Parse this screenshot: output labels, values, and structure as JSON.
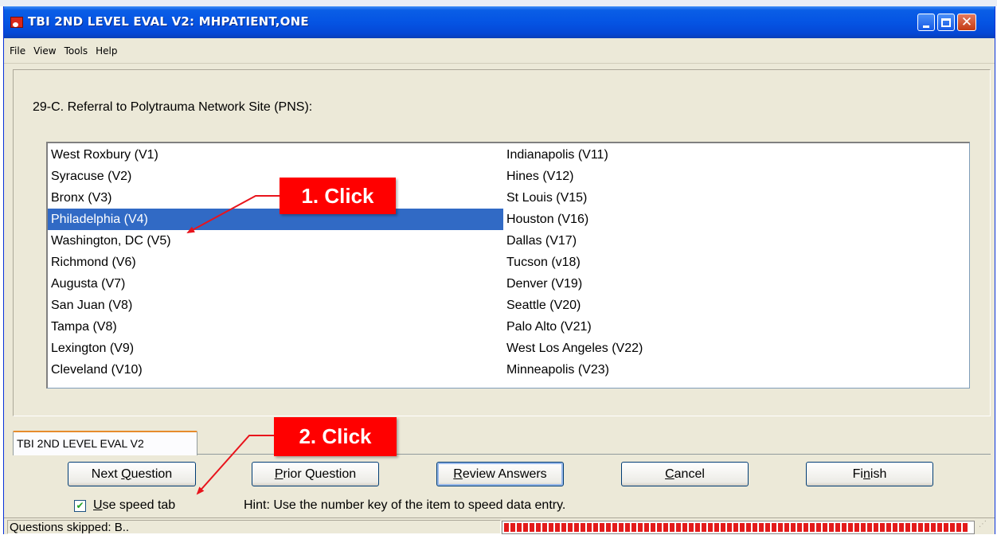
{
  "window": {
    "title": "TBI 2ND LEVEL EVAL V2: MHPATIENT,ONE",
    "controls": {
      "minimize": "minimize-icon",
      "maximize": "maximize-icon",
      "close": "close-icon"
    }
  },
  "menu": [
    "File",
    "View",
    "Tools",
    "Help"
  ],
  "question": {
    "label": "29-C. Referral to Polytrauma Network Site (PNS):"
  },
  "list": {
    "left": [
      "West Roxbury (V1)",
      "Syracuse (V2)",
      "Bronx (V3)",
      "Philadelphia (V4)",
      "Washington, DC (V5)",
      "Richmond (V6)",
      "Augusta (V7)",
      "San Juan (V8)",
      "Tampa (V8)",
      "Lexington (V9)",
      "Cleveland (V10)"
    ],
    "right": [
      "Indianapolis (V11)",
      "Hines (V12)",
      "St Louis (V15)",
      "Houston (V16)",
      "Dallas (V17)",
      "Tucson (v18)",
      "Denver (V19)",
      "Seattle (V20)",
      "Palo Alto (V21)",
      "West Los Angeles (V22)",
      "Minneapolis (V23)"
    ],
    "selected": "Philadelphia (V4)"
  },
  "callouts": {
    "first": "1. Click",
    "second": "2. Click"
  },
  "tab": {
    "label": "TBI 2ND LEVEL EVAL V2"
  },
  "buttons": {
    "next": "Next Question",
    "prior": "Prior Question",
    "review": "Review Answers",
    "cancel": "Cancel",
    "finish": "Finish"
  },
  "speed_tab": {
    "label": "Use speed tab",
    "checked": true
  },
  "hint": "Hint: Use the number key of the item to speed data entry.",
  "status": {
    "text": "Questions skipped: B..",
    "progress_fraction": 0.99
  },
  "colors": {
    "selection": "#316ac5",
    "callout": "#ff0000",
    "titlebar": "#0554e3",
    "progress": "#e31b1b"
  }
}
